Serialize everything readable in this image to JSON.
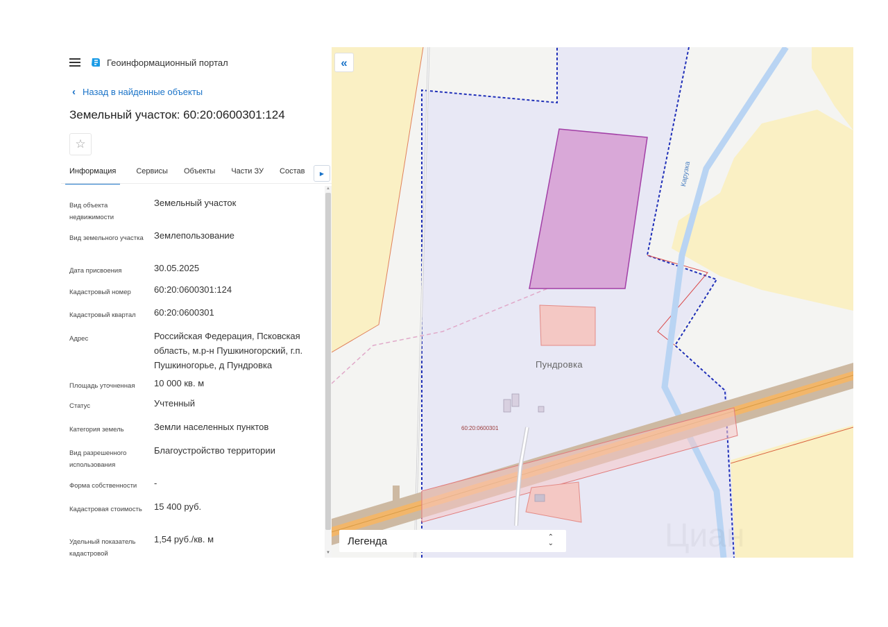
{
  "header": {
    "app_title": "Геоинформационный портал"
  },
  "nav": {
    "back_label": "Назад в найденные объекты"
  },
  "object": {
    "title": "Земельный участок: 60:20:0600301:124"
  },
  "tabs": [
    {
      "label": "Информация",
      "active": true
    },
    {
      "label": "Сервисы",
      "active": false
    },
    {
      "label": "Объекты",
      "active": false
    },
    {
      "label": "Части ЗУ",
      "active": false
    },
    {
      "label": "Состав",
      "active": false
    }
  ],
  "properties": [
    {
      "label": "Вид объекта недвижимости",
      "value": "Земельный участок"
    },
    {
      "label": "Вид земельного участка",
      "value": "Землепользование"
    },
    {
      "label": "Дата присвоения",
      "value": "30.05.2025"
    },
    {
      "label": "Кадастровый номер",
      "value": "60:20:0600301:124"
    },
    {
      "label": "Кадастровый квартал",
      "value": "60:20:0600301"
    },
    {
      "label": "Адрес",
      "value": "Российская Федерация, Псковская область, м.р-н Пушкиногорский, г.п. Пушкиногорье, д Пундровка"
    },
    {
      "label": "Площадь уточненная",
      "value": "10 000 кв. м"
    },
    {
      "label": "Статус",
      "value": "Учтенный"
    },
    {
      "label": "Категория земель",
      "value": "Земли населенных пунктов"
    },
    {
      "label": "Вид разрешенного использования",
      "value": "Благоустройство территории"
    },
    {
      "label": "Форма собственности",
      "value": "-"
    },
    {
      "label": "Кадастровая стоимость",
      "value": "15 400 руб."
    },
    {
      "label": "Удельный показатель кадастровой",
      "value": "1,54 руб./кв. м"
    }
  ],
  "map": {
    "collapse_symbol": "«",
    "legend_label": "Легенда",
    "village_label": "Пундровка",
    "quarter_label": "60:20:0600301",
    "river_label": "Карузка",
    "colors": {
      "parcel_fill": "#d9a8d8",
      "parcel_stroke": "#a23fa6",
      "road": "#f2b66a",
      "forest": "#faf0c4",
      "boundary_dashed": "#1f2fb8",
      "river": "#b9d4f3",
      "accent": "#1a73c8"
    }
  }
}
